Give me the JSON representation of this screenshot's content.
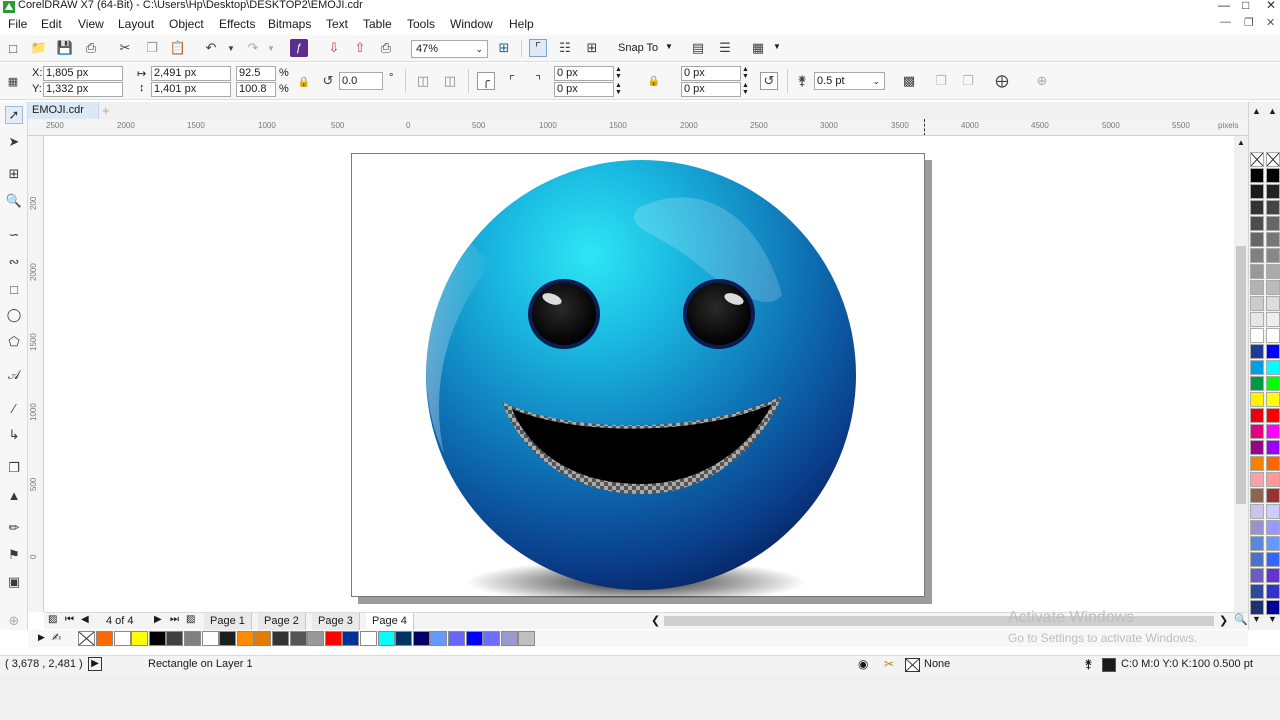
{
  "window": {
    "title": "CorelDRAW X7 (64-Bit) - C:\\Users\\Hp\\Desktop\\DESKTOP2\\EMOJI.cdr"
  },
  "menu": [
    "File",
    "Edit",
    "View",
    "Layout",
    "Object",
    "Effects",
    "Bitmaps",
    "Text",
    "Table",
    "Tools",
    "Window",
    "Help"
  ],
  "standard_toolbar": {
    "zoom": "47%",
    "snap_to": "Snap To"
  },
  "property_bar": {
    "x_label": "X:",
    "x": "1,805 px",
    "y_label": "Y:",
    "y": "1,332 px",
    "width": "2,491 px",
    "height": "1,401 px",
    "scale_x": "92.5",
    "scale_y": "100.8",
    "pct": "%",
    "rotation": "0.0",
    "deg": "°",
    "corner_tl": "0 px",
    "corner_bl": "0 px",
    "corner_tr": "0 px",
    "corner_br": "0 px",
    "outline_width": "0.5 pt"
  },
  "document": {
    "tab": "EMOJI.cdr"
  },
  "ruler": {
    "h_ticks": [
      "2500",
      "2000",
      "1500",
      "1000",
      "500",
      "0",
      "500",
      "1000",
      "1500",
      "2000",
      "2500",
      "3000",
      "3500",
      "4000",
      "4500",
      "5000",
      "5500"
    ],
    "v_ticks": [
      "200",
      "2000",
      "1500",
      "1000",
      "500",
      "0"
    ],
    "unit": "pixels"
  },
  "page_nav": {
    "counter": "4 of 4",
    "pages": [
      "Page 1",
      "Page 2",
      "Page 3",
      "Page 4"
    ],
    "active_page": "Page 4"
  },
  "status": {
    "coords": "( 3,678 , 2,481 )",
    "object": "Rectangle on Layer 1",
    "fill": "None",
    "outline": "C:0 M:0 Y:0 K:100  0.500 pt"
  },
  "watermark": {
    "line1": "Activate Windows",
    "line2": "Go to Settings to activate Windows."
  },
  "colors": {
    "strip": [
      "#ff6a00",
      "#ffffff",
      "#ffff00",
      "#000000",
      "#404040",
      "#808080",
      "#ffffff",
      "#1e1e1e",
      "#ff8c00",
      "#e57c00",
      "#333333",
      "#555555",
      "#999999",
      "#ff0000",
      "#003399",
      "#ffffff",
      "#00ffff",
      "#003366",
      "#000066",
      "#6699ff",
      "#6666ff",
      "#0000ff",
      "#6f6fff",
      "#9999cc",
      "#bfbfbf"
    ],
    "palette_left": [
      "#000000",
      "#1a1a1a",
      "#333333",
      "#4d4d4d",
      "#666666",
      "#808080",
      "#999999",
      "#b3b3b3",
      "#cccccc",
      "#e6e6e6",
      "#ffffff",
      "#1f3a93",
      "#00a0e9",
      "#009944",
      "#fff100",
      "#e60012",
      "#e4007f",
      "#920783",
      "#f08300",
      "#f5a2a8",
      "#8c6450",
      "#c9c4e8",
      "#9893cf",
      "#5c87d8",
      "#4d73c7",
      "#6a5dbf",
      "#2f4a9c",
      "#1e3170"
    ],
    "palette_right": [
      "#000000",
      "#222222",
      "#444444",
      "#666666",
      "#777777",
      "#888888",
      "#aaaaaa",
      "#bbbbbb",
      "#dddddd",
      "#eeeeee",
      "#ffffff",
      "#0000ff",
      "#00ffff",
      "#00ff00",
      "#ffff00",
      "#ff0000",
      "#ff00ff",
      "#9900ff",
      "#ff6600",
      "#ff9999",
      "#993333",
      "#ccccff",
      "#9999ff",
      "#6699ff",
      "#3366ff",
      "#6633cc",
      "#3333cc",
      "#000099"
    ]
  }
}
